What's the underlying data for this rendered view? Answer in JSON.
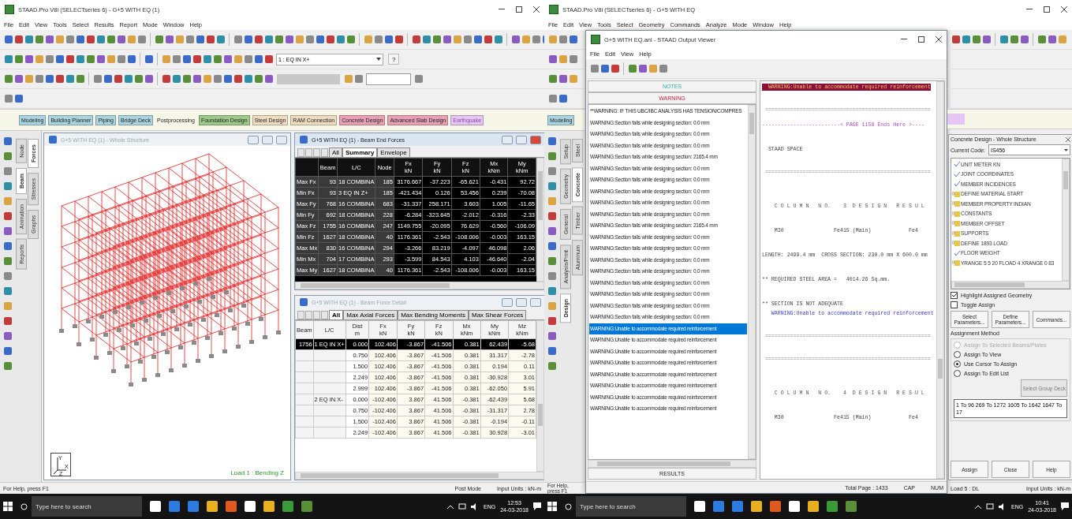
{
  "left": {
    "title": "STAAD.Pro V8i (SELECTseries 6) - G+5 WITH EQ (1)",
    "menu": [
      "File",
      "Edit",
      "View",
      "Tools",
      "Select",
      "Results",
      "Report",
      "Mode",
      "Window",
      "Help"
    ],
    "load_case": "1 : EQ IN X+",
    "help_button": "?",
    "modes": [
      {
        "label": "Modeling",
        "color": "#a9d4e0",
        "selected": false,
        "disabled": false
      },
      {
        "label": "Building Planner",
        "color": "#a9d4e0",
        "selected": false,
        "disabled": false
      },
      {
        "label": "Piping",
        "color": "#a9d4e0",
        "selected": false,
        "disabled": false
      },
      {
        "label": "Bridge Deck",
        "color": "#a9d4e0",
        "selected": false,
        "disabled": false
      },
      {
        "label": "Postprocessing",
        "color": "#f6f7e8",
        "selected": true,
        "disabled": false
      },
      {
        "label": "Foundation Design",
        "color": "#9dc98a",
        "selected": false,
        "disabled": false
      },
      {
        "label": "Steel Design",
        "color": "#eedcc0",
        "selected": false,
        "disabled": false
      },
      {
        "label": "RAM Connection",
        "color": "#eedcc0",
        "selected": false,
        "disabled": false
      },
      {
        "label": "Concrete Design",
        "color": "#e8a0b4",
        "selected": false,
        "disabled": false
      },
      {
        "label": "Advanced Slab Design",
        "color": "#e8a0b4",
        "selected": false,
        "disabled": false
      },
      {
        "label": "Earthquake",
        "color": "#e6c6f4",
        "selected": false,
        "disabled": true
      }
    ],
    "side_tabs_outer": [
      {
        "label": "Node",
        "selected": false
      },
      {
        "label": "Beam",
        "selected": true
      },
      {
        "label": "Animation",
        "selected": false
      },
      {
        "label": "Reports",
        "selected": false
      }
    ],
    "side_tabs_inner": [
      {
        "label": "Forces",
        "selected": true
      },
      {
        "label": "Stresses",
        "selected": false
      },
      {
        "label": "Graphs",
        "selected": false
      }
    ],
    "viewport": {
      "title": "G+5 WITH EQ (1) - Whole Structure",
      "axis_labels": [
        "Y",
        "X",
        "Z"
      ],
      "load_label": "Load 1 : Bending Z"
    },
    "beam_end_forces": {
      "title": "G+5 WITH EQ (1) - Beam End Forces",
      "tabs": [
        {
          "label": "All",
          "selected": false
        },
        {
          "label": "Summary",
          "selected": true
        },
        {
          "label": "Envelope",
          "selected": false
        }
      ],
      "columns": [
        {
          "name": "Beam"
        },
        {
          "name": "L/C"
        },
        {
          "name": "Node"
        },
        {
          "name": "Fx",
          "unit": "kN"
        },
        {
          "name": "Fy",
          "unit": "kN"
        },
        {
          "name": "Fz",
          "unit": "kN"
        },
        {
          "name": "Mx",
          "unit": "kNm"
        },
        {
          "name": "My",
          "unit": "kNm"
        }
      ],
      "rows": [
        {
          "label": "Max Fx",
          "cells": [
            "93",
            "18 COMBINA",
            "185",
            "3176.667",
            "-37.223",
            "-65.621",
            "-0.431",
            "92.72"
          ]
        },
        {
          "label": "Min Fx",
          "cells": [
            "93",
            "3 EQ IN Z+",
            "185",
            "-421.434",
            "0.126",
            "53.456",
            "0.239",
            "-70.08"
          ]
        },
        {
          "label": "Max Fy",
          "cells": [
            "768",
            "16 COMBINA",
            "683",
            "-31.337",
            "258.171",
            "3.603",
            "1.005",
            "-11.65"
          ]
        },
        {
          "label": "Min Fy",
          "cells": [
            "692",
            "18 COMBINA",
            "228",
            "-6.284",
            "-323.645",
            "-2.012",
            "-0.316",
            "-2.33"
          ]
        },
        {
          "label": "Max Fz",
          "cells": [
            "1755",
            "16 COMBINA",
            "247",
            "1149.755",
            "-20.095",
            "76.629",
            "-0.560",
            "-106.09"
          ]
        },
        {
          "label": "Min Fz",
          "cells": [
            "1627",
            "18 COMBINA",
            "40",
            "1176.361",
            "-2.543",
            "-108.006",
            "-0.003",
            "163.15"
          ]
        },
        {
          "label": "Max Mx",
          "cells": [
            "830",
            "16 COMBINA",
            "294",
            "-3.266",
            "83.219",
            "-4.097",
            "46.098",
            "2.06"
          ]
        },
        {
          "label": "Min Mx",
          "cells": [
            "704",
            "17 COMBINA",
            "293",
            "-3.599",
            "84.543",
            "4.103",
            "-46.640",
            "-2.04"
          ]
        },
        {
          "label": "Max My",
          "cells": [
            "1627",
            "18 COMBINA",
            "40",
            "1176.361",
            "-2.543",
            "-108.006",
            "-0.003",
            "163.15"
          ]
        }
      ]
    },
    "beam_force_detail": {
      "title": "G+5 WITH EQ (1) - Beam Force Detail",
      "tabs": [
        {
          "label": "All",
          "selected": true
        },
        {
          "label": "Max Axial Forces",
          "selected": false
        },
        {
          "label": "Max Bending Moments",
          "selected": false
        },
        {
          "label": "Max Shear Forces",
          "selected": false
        }
      ],
      "columns": [
        {
          "name": "Beam"
        },
        {
          "name": "L/C"
        },
        {
          "name": "Dist",
          "unit": "m"
        },
        {
          "name": "Fx",
          "unit": "kN"
        },
        {
          "name": "Fy",
          "unit": "kN"
        },
        {
          "name": "Fz",
          "unit": "kN"
        },
        {
          "name": "Mx",
          "unit": "kNm"
        },
        {
          "name": "My",
          "unit": "kNm"
        },
        {
          "name": "Mz",
          "unit": "kNm"
        }
      ],
      "rows": [
        {
          "selected": true,
          "cells": [
            "1756",
            "1 EQ IN X+",
            "0.000",
            "102.406",
            "-3.867",
            "-41.506",
            "0.381",
            "62.439",
            "-5.68"
          ]
        },
        {
          "selected": false,
          "cells": [
            "",
            "",
            "0.750",
            "102.406",
            "-3.867",
            "-41.506",
            "0.381",
            "31.317",
            "-2.78"
          ]
        },
        {
          "selected": false,
          "cells": [
            "",
            "",
            "1.500",
            "102.406",
            "-3.867",
            "-41.506",
            "0.381",
            "0.194",
            "0.11"
          ]
        },
        {
          "selected": false,
          "cells": [
            "",
            "",
            "2.249",
            "102.406",
            "-3.867",
            "-41.506",
            "0.381",
            "-30.928",
            "3.01"
          ]
        },
        {
          "selected": false,
          "cells": [
            "",
            "",
            "2.999",
            "102.406",
            "-3.867",
            "-41.506",
            "0.381",
            "-62.050",
            "5.91"
          ]
        },
        {
          "selected": false,
          "cells": [
            "",
            "2 EQ IN X-",
            "0.000",
            "-102.406",
            "3.867",
            "41.506",
            "-0.381",
            "-62.439",
            "5.68"
          ]
        },
        {
          "selected": false,
          "cells": [
            "",
            "",
            "0.750",
            "-102.406",
            "3.867",
            "41.506",
            "-0.381",
            "-31.317",
            "2.78"
          ]
        },
        {
          "selected": false,
          "cells": [
            "",
            "",
            "1.500",
            "-102.406",
            "3.867",
            "41.506",
            "-0.381",
            "-0.194",
            "-0.11"
          ]
        },
        {
          "selected": false,
          "cells": [
            "",
            "",
            "2.249",
            "-102.406",
            "3.867",
            "41.506",
            "-0.381",
            "30.928",
            "-3.01"
          ]
        }
      ]
    },
    "status_bar": [
      "For Help, press F1",
      "Post Mode",
      "Input Units : kN-m"
    ],
    "taskbar": {
      "search_placeholder": "Type here to search",
      "language": "ENG",
      "time": "12:53",
      "date": "24-03-2018"
    }
  },
  "right": {
    "title": "STAAD.Pro V8i (SELECTseries 6) - G+5 WITH EQ",
    "menu": [
      "File",
      "Edit",
      "View",
      "Tools",
      "Select",
      "Geometry",
      "Commands",
      "Analyze",
      "Mode",
      "Window",
      "Help"
    ],
    "mode_tab": {
      "label": "Modeling",
      "color": "#a9d4e0",
      "selected": false
    },
    "side_tabs_outer": [
      {
        "label": "Setup",
        "selected": false
      },
      {
        "label": "Geometry",
        "selected": false
      },
      {
        "label": "General",
        "selected": false
      },
      {
        "label": "Analysis/Print",
        "selected": false
      },
      {
        "label": "Design",
        "selected": true
      }
    ],
    "side_tabs_inner": [
      {
        "label": "Steel",
        "selected": false
      },
      {
        "label": "Concrete",
        "selected": true
      },
      {
        "label": "Timber",
        "selected": false
      },
      {
        "label": "Aluminum",
        "selected": false
      }
    ],
    "output_viewer": {
      "title": "G+5 WITH EQ.anl - STAAD Output Viewer",
      "menu": [
        "File",
        "Edit",
        "View",
        "Help"
      ],
      "notes_button": "NOTES",
      "warning_button": "WARNING",
      "results_button": "RESULTS",
      "messages": [
        {
          "text": "**WARNING: IF THIS UBC/IBC ANALYSIS HAS TENSION/COMPRES",
          "selected": false
        },
        {
          "text": "WARNING:Section fails while designing section:  0.0 mm",
          "selected": false
        },
        {
          "text": "WARNING:Section fails while designing section:  0.0 mm",
          "selected": false
        },
        {
          "text": "WARNING:Section fails while designing section:  0.0 mm",
          "selected": false
        },
        {
          "text": "WARNING:Section fails while designing section: 2165.4 mm",
          "selected": false
        },
        {
          "text": "WARNING:Section fails while designing section:  0.0 mm",
          "selected": false
        },
        {
          "text": "WARNING:Section fails while designing section:  0.0 mm",
          "selected": false
        },
        {
          "text": "WARNING:Section fails while designing section:  0.0 mm",
          "selected": false
        },
        {
          "text": "WARNING:Section fails while designing section:  0.0 mm",
          "selected": false
        },
        {
          "text": "WARNING:Section fails while designing section:  0.0 mm",
          "selected": false
        },
        {
          "text": "WARNING:Section fails while designing section: 2165.4 mm",
          "selected": false
        },
        {
          "text": "WARNING:Section fails while designing section:  0.0 mm",
          "selected": false
        },
        {
          "text": "WARNING:Section fails while designing section:  0.0 mm",
          "selected": false
        },
        {
          "text": "WARNING:Section fails while designing section:  0.0 mm",
          "selected": false
        },
        {
          "text": "WARNING:Section fails while designing section:  0.0 mm",
          "selected": false
        },
        {
          "text": "WARNING:Section fails while designing section:  0.0 mm",
          "selected": false
        },
        {
          "text": "WARNING:Section fails while designing section:  0.0 mm",
          "selected": false
        },
        {
          "text": "WARNING:Section fails while designing section:  0.0 mm",
          "selected": false
        },
        {
          "text": "WARNING:Section fails while designing section:  0.0 mm",
          "selected": false
        },
        {
          "text": "WARNING:Unable to accommodate required reinforcement",
          "selected": true
        },
        {
          "text": "WARNING:Unable to accommodate required reinforcement",
          "selected": false
        },
        {
          "text": "WARNING:Unable to accommodate required reinforcement",
          "selected": false
        },
        {
          "text": "WARNING:Unable to accommodate required reinforcement",
          "selected": false
        },
        {
          "text": "WARNING:Unable to accommodate required reinforcement",
          "selected": false
        },
        {
          "text": "WARNING:Unable to accommodate required reinforcement",
          "selected": false
        },
        {
          "text": "WARNING:Unable to accommodate required reinforcement",
          "selected": false
        },
        {
          "text": "WARNING:Unable to accommodate required reinforcement",
          "selected": false
        }
      ],
      "lines": [
        {
          "kind": "highlight",
          "text": "  WARNING:Unable to accommodate required reinforcement"
        },
        {
          "kind": "rule",
          "text": " ====================================================="
        },
        {
          "kind": "page",
          "text": "-------------------------< PAGE 1158 Ends Here >----"
        },
        {
          "kind": "plain",
          "text": "  STAAD SPACE"
        },
        {
          "kind": "rule",
          "text": " ====================================================="
        },
        {
          "kind": "heading",
          "text": "    C O L U M N   N O.    3  D E S I G N   R E S U L"
        },
        {
          "kind": "plain",
          "text": "    M30                Fe415 (Main)            Fe4"
        },
        {
          "kind": "plain",
          "text": "LENGTH: 2499.4 mm  CROSS SECTION: 230.0 mm X 600.0 mm"
        },
        {
          "kind": "plain",
          "text": "** REQUIRED STEEL AREA =   4014.26 Sq.mm."
        },
        {
          "kind": "plain",
          "text": "** SECTION IS NOT ADEQUATE"
        },
        {
          "kind": "warning",
          "text": "   WARNING:Unable to accommodate required reinforcement"
        },
        {
          "kind": "rule",
          "text": " ====================================================="
        },
        {
          "kind": "rule",
          "text": " ====================================================="
        },
        {
          "kind": "heading",
          "text": "    C O L U M N   N O.    4  D E S I G N   R E S U L"
        },
        {
          "kind": "plain",
          "text": "    M30                Fe415 (Main)            Fe4"
        }
      ],
      "status": [
        "Total Page : 1433",
        "CAP",
        "NUM"
      ]
    },
    "concrete_design": {
      "title": "Concrete Design - Whole Structure",
      "code_label": "Current Code:",
      "code": "IS456",
      "tree": [
        {
          "kind": "check",
          "label": "UNIT METER KN"
        },
        {
          "kind": "check",
          "label": "JOINT COORDINATES"
        },
        {
          "kind": "check",
          "label": "MEMBER INCIDENCES"
        },
        {
          "kind": "folder",
          "label": "DEFINE MATERIAL START"
        },
        {
          "kind": "folder",
          "label": "MEMBER PROPERTY INDIAN"
        },
        {
          "kind": "folder",
          "label": "CONSTANTS"
        },
        {
          "kind": "folder",
          "label": "MEMBER OFFSET"
        },
        {
          "kind": "folder",
          "label": "SUPPORTS"
        },
        {
          "kind": "folder",
          "label": "DEFINE 1893 LOAD"
        },
        {
          "kind": "check",
          "label": "FLOOR WEIGHT"
        },
        {
          "kind": "folder",
          "label": "YRANGE 5 5 20 FLOAD 4 XRANGE 0 83"
        }
      ],
      "options": [
        {
          "label": "Highlight Assigned Geometry",
          "checked": true
        },
        {
          "label": "Toggle Assign",
          "checked": false
        }
      ],
      "buttons": [
        "Select Parameters...",
        "Define Parameters...",
        "Commands..."
      ],
      "method_label": "Assignment Method",
      "methods": [
        {
          "label": "Assign To Selected Beams/Plates",
          "selected": false,
          "disabled": true
        },
        {
          "label": "Assign To View",
          "selected": false,
          "disabled": false
        },
        {
          "label": "Use Cursor To Assign",
          "selected": true,
          "disabled": false
        },
        {
          "label": "Assign To Edit List",
          "selected": false,
          "disabled": false
        }
      ],
      "group_button": {
        "label": "Select Group Deck",
        "disabled": true
      },
      "edit_list": "1 To 96 269 To 1272 1605 To 1642 1647 To 17",
      "actions": [
        "Assign",
        "Close",
        "Help"
      ]
    },
    "status_left": "For Help, press F1",
    "status_right": [
      "Load 5 : DL",
      "Input Units : kN-m"
    ],
    "taskbar": {
      "search_placeholder": "Type here to search",
      "language": "ENG",
      "time": "10:41",
      "date": "24-03-2018"
    }
  }
}
